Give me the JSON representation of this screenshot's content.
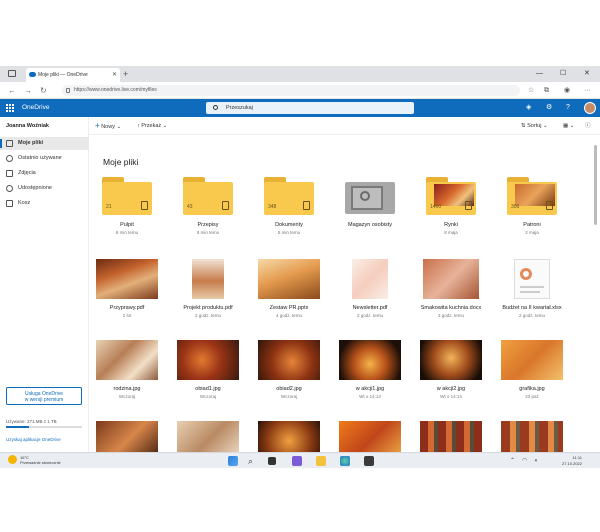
{
  "browser": {
    "tab_title": "Moje pliki — OneDrive",
    "url": "https://www.onedrive.live.com/myfiles"
  },
  "header": {
    "app_name": "OneDrive",
    "search_placeholder": "Przeszukaj"
  },
  "sidebar": {
    "user_name": "Joanna Woźniak",
    "items": [
      {
        "label": "Moje pliki",
        "icon": "folder-icon",
        "active": true
      },
      {
        "label": "Ostatnio używane",
        "icon": "clock-icon",
        "active": false
      },
      {
        "label": "Zdjęcia",
        "icon": "photo-icon",
        "active": false
      },
      {
        "label": "Udostępnione",
        "icon": "people-icon",
        "active": false
      },
      {
        "label": "Kosz",
        "icon": "trash-icon",
        "active": false
      }
    ],
    "premium_line1": "Usługa OneDrive",
    "premium_line2": "w wersji premium",
    "storage_text": "Używane: 271 MB z 1 TB",
    "get_apps": "Uzyskaj aplikacje OneDrive"
  },
  "commandbar": {
    "new_label": "Nowy",
    "upload_label": "Przekaż",
    "sort_label": "Sortuj"
  },
  "main": {
    "title": "Moje pliki",
    "row1": [
      {
        "name": "Pulpit",
        "meta": "8 min temu",
        "count": "21",
        "kind": "folder",
        "badge": "desktop-icon"
      },
      {
        "name": "Przepisy",
        "meta": "8 min temu",
        "count": "43",
        "kind": "folder",
        "badge": "document-icon"
      },
      {
        "name": "Dokumenty",
        "meta": "8 min temu",
        "count": "348",
        "kind": "folder",
        "badge": "document-icon"
      },
      {
        "name": "Magazyn osobisty",
        "meta": "",
        "count": "",
        "kind": "vault",
        "badge": "vault-icon"
      },
      {
        "name": "Rynki",
        "meta": "8 maja",
        "count": "1460",
        "kind": "photofolder",
        "badge": "photo-icon"
      },
      {
        "name": "Patroni",
        "meta": "2 maja",
        "count": "306",
        "kind": "photofolder",
        "badge": "photo-icon"
      }
    ],
    "row2": [
      {
        "name": "Przyprawy.pdf",
        "meta": "2 lut"
      },
      {
        "name": "Projekt produktu.pdf",
        "meta": "2 godz. temu"
      },
      {
        "name": "Zestaw PR.pptx",
        "meta": "4 godz. temu"
      },
      {
        "name": "Newsletter.pdf",
        "meta": "2 godz. temu"
      },
      {
        "name": "Smakowita kuchnia.docx",
        "meta": "3 godz. temu"
      },
      {
        "name": "Budżet na II kwartał.xlsx",
        "meta": "2 godz. temu"
      }
    ],
    "row3": [
      {
        "name": "rodzina.jpg",
        "meta": "Wczoraj"
      },
      {
        "name": "obiad1.jpg",
        "meta": "Wczoraj"
      },
      {
        "name": "obiad2.jpg",
        "meta": "Wczoraj"
      },
      {
        "name": "w akcji1.jpg",
        "meta": "Wt o 14:14"
      },
      {
        "name": "w akcji2.jpg",
        "meta": "Wt o 14:14"
      },
      {
        "name": "grafika.jpg",
        "meta": "23 paź"
      }
    ]
  },
  "taskbar": {
    "temperature": "16°C",
    "weather_text": "Przeważnie słonecznie",
    "time": "11:11",
    "date": "27.10.2022"
  }
}
